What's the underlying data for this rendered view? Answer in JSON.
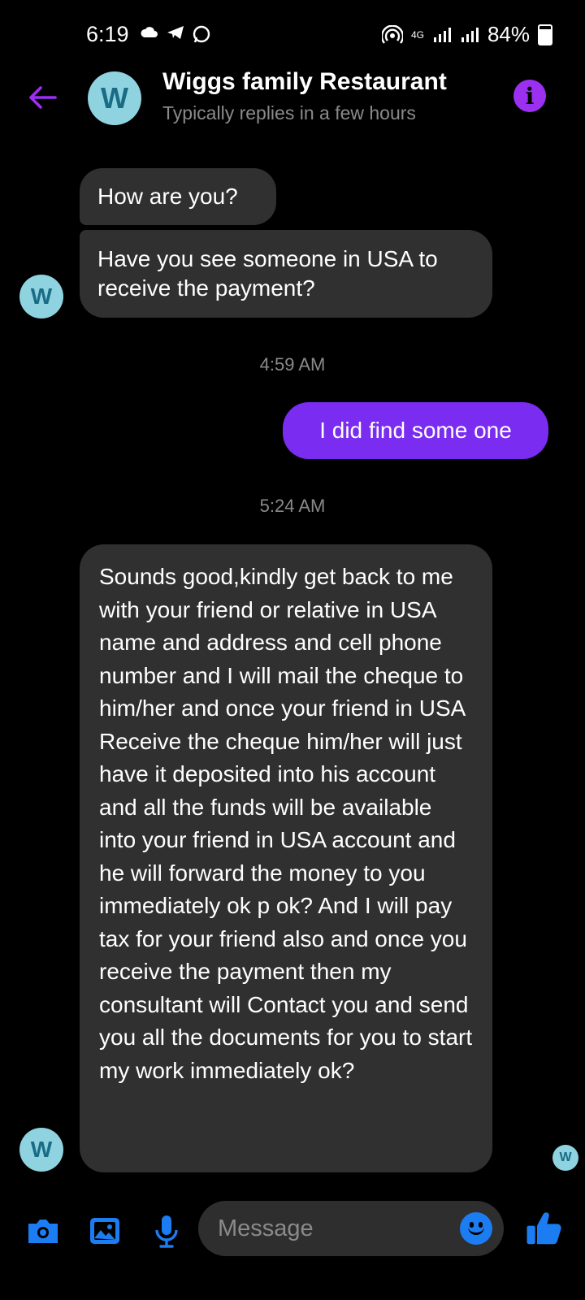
{
  "status_bar": {
    "time": "6:19",
    "network": "4G",
    "battery": "84%"
  },
  "header": {
    "contact_name": "Wiggs family Restaurant",
    "contact_status": "Typically replies in a few hours",
    "avatar_letter": "W"
  },
  "messages": [
    {
      "side": "received",
      "text": "How are you?"
    },
    {
      "side": "received",
      "text": "Have you see someone in USA to receive the payment?"
    },
    {
      "side": "sent",
      "text": "I did find some one"
    },
    {
      "side": "received",
      "text": "Sounds good,kindly get back to me with your friend or relative in USA name and address and cell phone number and I will mail the cheque to him/her and once your friend in USA Receive the cheque him/her will just have it deposited into his account and all the funds will be available into your friend in USA account and he will forward the money to you immediately ok p ok? And I will pay tax for your friend also and once you receive the payment then my consultant will Contact you and send you all the documents for you to start my work immediately ok?"
    }
  ],
  "timestamps": [
    "4:59 AM",
    "5:24 AM"
  ],
  "composer": {
    "placeholder": "Message"
  },
  "colors": {
    "accent": "#9b30f0",
    "sent_bubble": "#7a2cf0",
    "received_bubble": "#303030",
    "icon_blue": "#1c7cf2",
    "avatar_bg": "#8fd3e0"
  }
}
